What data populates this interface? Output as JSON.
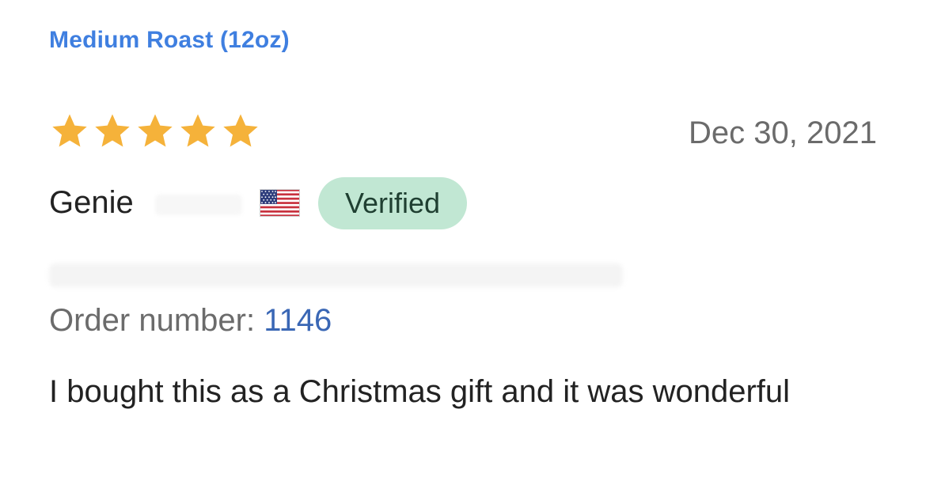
{
  "review": {
    "variant": "Medium Roast (12oz)",
    "rating": 5,
    "rating_max": 5,
    "date": "Dec 30, 2021",
    "reviewer_name": "Genie",
    "country_flag_icon": "us-flag-icon",
    "verified_label": "Verified",
    "order_label": "Order number:",
    "order_number": "1146",
    "body": "I bought this as a Christmas gift and it was wonderful"
  },
  "colors": {
    "link_blue": "#3f7fe0",
    "star_gold": "#f5b23a",
    "badge_green": "#c1e7d3",
    "muted_text": "#6b6b6b",
    "primary_text": "#222222"
  }
}
